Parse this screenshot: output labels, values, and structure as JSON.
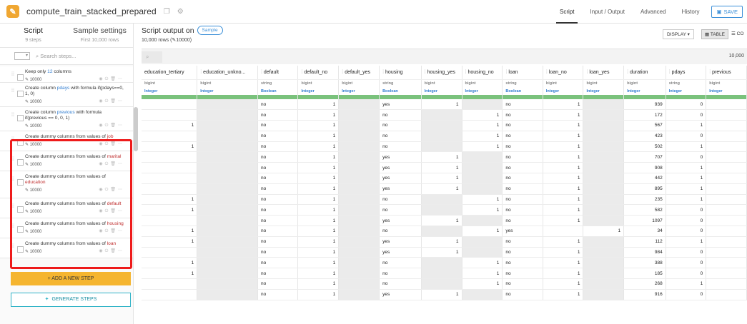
{
  "header": {
    "title": "compute_train_stacked_prepared",
    "nav": [
      "Script",
      "Input / Output",
      "Advanced",
      "History"
    ],
    "active_nav": "Script",
    "save_label": "SAVE"
  },
  "sidebar": {
    "tabs": [
      {
        "label": "Script",
        "sub": "9 steps"
      },
      {
        "label": "Sample settings",
        "sub": "First 10,000 rows"
      }
    ],
    "search_placeholder": "Search steps...",
    "steps": [
      {
        "pre": "Keep only ",
        "hl": "12",
        "post": " columns",
        "count": "10000"
      },
      {
        "pre": "Create column ",
        "hl": "pdays",
        "post": " with formula if(pdays==0, 1, 0)",
        "count": "10000"
      },
      {
        "pre": "Create column ",
        "hl": "previous",
        "post": " with formula if(previous == 0, 0, 1)",
        "count": "10000"
      },
      {
        "pre": "Create dummy columns from values of ",
        "hl": "job",
        "post": "",
        "count": "10000"
      },
      {
        "pre": "Create dummy columns from values of ",
        "hl": "marital",
        "post": "",
        "count": "10000"
      },
      {
        "pre": "Create dummy columns from values of ",
        "hl": "education",
        "post": "",
        "count": "10000"
      },
      {
        "pre": "Create dummy columns from values of ",
        "hl": "default",
        "post": "",
        "count": "10000"
      },
      {
        "pre": "Create dummy columns from values of ",
        "hl": "housing",
        "post": "",
        "count": "10000"
      },
      {
        "pre": "Create dummy columns from values of ",
        "hl": "loan",
        "post": "",
        "count": "10000"
      }
    ],
    "add_step_label": "+ ADD A NEW STEP",
    "generate_label": "GENERATE STEPS"
  },
  "main": {
    "title": "Script output on",
    "sample_label": "Sample",
    "rows_label": "10,000 rows (",
    "rows_label_count": "10000)",
    "display_label": "DISPLAY ▾",
    "table_label": "TABLE",
    "columns_label": "CO",
    "row_count": "10,000"
  },
  "table": {
    "columns": [
      {
        "name": "education_tertiary",
        "type": "bigint",
        "mean": "Integer"
      },
      {
        "name": "education_unkno...",
        "type": "bigint",
        "mean": "Integer"
      },
      {
        "name": "default",
        "type": "string",
        "mean": "Boolean"
      },
      {
        "name": "default_no",
        "type": "bigint",
        "mean": "Integer"
      },
      {
        "name": "default_yes",
        "type": "bigint",
        "mean": "Integer"
      },
      {
        "name": "housing",
        "type": "string",
        "mean": "Boolean"
      },
      {
        "name": "housing_yes",
        "type": "bigint",
        "mean": "Integer"
      },
      {
        "name": "housing_no",
        "type": "bigint",
        "mean": "Integer"
      },
      {
        "name": "loan",
        "type": "string",
        "mean": "Boolean"
      },
      {
        "name": "loan_no",
        "type": "bigint",
        "mean": "Integer"
      },
      {
        "name": "loan_yes",
        "type": "bigint",
        "mean": "Integer"
      },
      {
        "name": "duration",
        "type": "bigint",
        "mean": "Integer"
      },
      {
        "name": "pdays",
        "type": "string",
        "mean": "Integer"
      },
      {
        "name": "previous",
        "type": "bigint",
        "mean": "Integer"
      }
    ],
    "rows": [
      [
        "",
        "",
        "no",
        "1",
        "",
        "yes",
        "1",
        "",
        "no",
        "1",
        "",
        "939",
        "0",
        ""
      ],
      [
        "",
        "",
        "no",
        "1",
        "",
        "no",
        "",
        "1",
        "no",
        "1",
        "",
        "172",
        "0",
        ""
      ],
      [
        "1",
        "",
        "no",
        "1",
        "",
        "no",
        "",
        "1",
        "no",
        "1",
        "",
        "567",
        "1",
        ""
      ],
      [
        "",
        "",
        "no",
        "1",
        "",
        "no",
        "",
        "1",
        "no",
        "1",
        "",
        "423",
        "0",
        ""
      ],
      [
        "1",
        "",
        "no",
        "1",
        "",
        "no",
        "",
        "1",
        "no",
        "1",
        "",
        "502",
        "1",
        ""
      ],
      [
        "",
        "",
        "no",
        "1",
        "",
        "yes",
        "1",
        "",
        "no",
        "1",
        "",
        "707",
        "0",
        ""
      ],
      [
        "",
        "",
        "no",
        "1",
        "",
        "yes",
        "1",
        "",
        "no",
        "1",
        "",
        "908",
        "1",
        ""
      ],
      [
        "",
        "",
        "no",
        "1",
        "",
        "yes",
        "1",
        "",
        "no",
        "1",
        "",
        "442",
        "1",
        ""
      ],
      [
        "",
        "",
        "no",
        "1",
        "",
        "yes",
        "1",
        "",
        "no",
        "1",
        "",
        "895",
        "1",
        ""
      ],
      [
        "1",
        "",
        "no",
        "1",
        "",
        "no",
        "",
        "1",
        "no",
        "1",
        "",
        "235",
        "1",
        ""
      ],
      [
        "1",
        "",
        "no",
        "1",
        "",
        "no",
        "",
        "1",
        "no",
        "1",
        "",
        "582",
        "0",
        ""
      ],
      [
        "",
        "",
        "no",
        "1",
        "",
        "yes",
        "1",
        "",
        "no",
        "1",
        "",
        "1097",
        "0",
        ""
      ],
      [
        "1",
        "",
        "no",
        "1",
        "",
        "no",
        "",
        "1",
        "yes",
        "",
        "1",
        "34",
        "0",
        ""
      ],
      [
        "1",
        "",
        "no",
        "1",
        "",
        "yes",
        "1",
        "",
        "no",
        "1",
        "",
        "112",
        "1",
        ""
      ],
      [
        "",
        "",
        "no",
        "1",
        "",
        "yes",
        "1",
        "",
        "no",
        "1",
        "",
        "984",
        "0",
        ""
      ],
      [
        "1",
        "",
        "no",
        "1",
        "",
        "no",
        "",
        "1",
        "no",
        "1",
        "",
        "388",
        "0",
        ""
      ],
      [
        "1",
        "",
        "no",
        "1",
        "",
        "no",
        "",
        "1",
        "no",
        "1",
        "",
        "185",
        "0",
        ""
      ],
      [
        "",
        "",
        "no",
        "1",
        "",
        "no",
        "",
        "1",
        "no",
        "1",
        "",
        "268",
        "1",
        ""
      ],
      [
        "",
        "",
        "no",
        "1",
        "",
        "yes",
        "1",
        "",
        "no",
        "1",
        "",
        "916",
        "0",
        ""
      ]
    ]
  },
  "colors": {
    "accent": "#3b8fd8",
    "add_button": "#f5b530",
    "selection": "#ee1b1b",
    "quality_bar": "#7ac27c"
  }
}
